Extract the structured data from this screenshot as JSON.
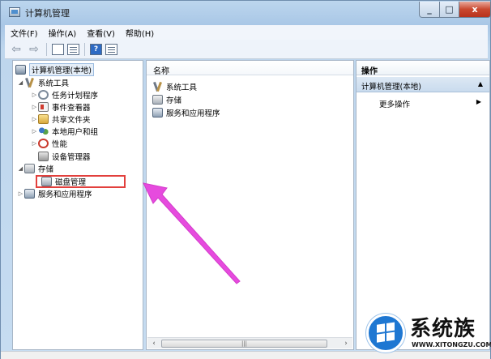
{
  "window": {
    "title": "计算机管理",
    "min_glyph": "_",
    "max_glyph": "□",
    "close_glyph": "x"
  },
  "menu": [
    "文件(F)",
    "操作(A)",
    "查看(V)",
    "帮助(H)"
  ],
  "toolbar": {
    "back_icon": "back-arrow-icon",
    "forward_icon": "forward-arrow-icon",
    "help_label": "?"
  },
  "tree": {
    "root": "计算机管理(本地)",
    "system_tools": "系统工具",
    "task_scheduler": "任务计划程序",
    "event_viewer": "事件查看器",
    "shared_folders": "共享文件夹",
    "local_users": "本地用户和组",
    "performance": "性能",
    "device_manager": "设备管理器",
    "storage": "存储",
    "disk_management": "磁盘管理",
    "services_apps": "服务和应用程序"
  },
  "middle": {
    "column_header": "名称",
    "items": [
      "系统工具",
      "存储",
      "服务和应用程序"
    ]
  },
  "actions": {
    "title": "操作",
    "group": "计算机管理(本地)",
    "more": "更多操作"
  },
  "watermark": {
    "brand": "系统族",
    "url": "WWW.XITONGZU.COM"
  },
  "colors": {
    "highlight_border": "#e2403d",
    "arrow": "#e64bde"
  }
}
